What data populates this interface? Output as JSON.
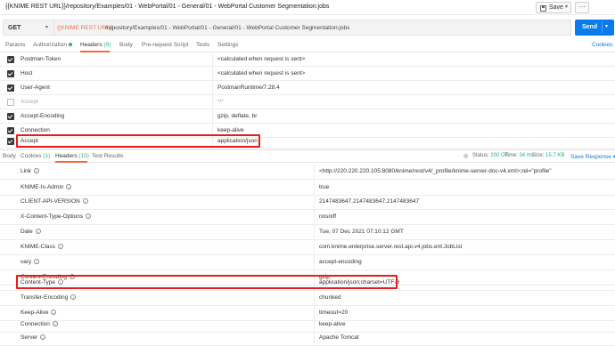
{
  "window": {
    "title": "{{KNIME REST URL}}/repository/Examples/01 - WebPortal/01 - General/01 - WebPortal Customer Segmentation:jobs",
    "save_label": "Save",
    "more_label": "···"
  },
  "request": {
    "method": "GET",
    "url_variable": "{{KNIME REST URL}}",
    "url_path": "/repository/Examples/01 - WebPortal/01 - General/01 - WebPortal Customer Segmentation:jobs",
    "send_label": "Send"
  },
  "request_tabs": [
    {
      "label": "Params"
    },
    {
      "label": "Authorization"
    },
    {
      "label": "Headers",
      "count": "(9)"
    },
    {
      "label": "Body"
    },
    {
      "label": "Pre-request Script"
    },
    {
      "label": "Tests"
    },
    {
      "label": "Settings"
    }
  ],
  "cookies_label": "Cookies",
  "request_headers": [
    {
      "key": "Postman-Token",
      "value": "<calculated when request is sent>",
      "enabled": true
    },
    {
      "key": "Host",
      "value": "<calculated when request is sent>",
      "enabled": true
    },
    {
      "key": "User-Agent",
      "value": "PostmanRuntime/7.28.4",
      "enabled": true
    },
    {
      "key": "Accept",
      "value": "*/*",
      "enabled": false
    },
    {
      "key": "Accept-Encoding",
      "value": "gzip, deflate, br",
      "enabled": true
    },
    {
      "key": "Connection",
      "value": "keep-alive",
      "enabled": true
    },
    {
      "key": "Accept",
      "value": "application/json",
      "enabled": true
    }
  ],
  "response_tabs": [
    {
      "label": "Body"
    },
    {
      "label": "Cookies",
      "count": "(1)"
    },
    {
      "label": "Headers",
      "count": "(15)"
    },
    {
      "label": "Test Results"
    }
  ],
  "response_status": {
    "status_label": "Status:",
    "status_value": "200 OK",
    "time_label": "Time:",
    "time_value": "34 ms",
    "size_label": "Size:",
    "size_value": "15.7 KB",
    "save_response_label": "Save Response"
  },
  "response_headers": [
    {
      "key": "Link",
      "value": "<http://220.220.220.105:8080/knime/rest/v4/_profile/knime-server-doc-v4.xml>;rel=\"profile\""
    },
    {
      "key": "KNIME-Is-Admin",
      "value": "true"
    },
    {
      "key": "CLIENT-API-VERSION",
      "value": "2147483647.2147483647.2147483647"
    },
    {
      "key": "X-Content-Type-Options",
      "value": "nosniff"
    },
    {
      "key": "Date",
      "value": "Tue, 07 Dec 2021 07:10:12 GMT"
    },
    {
      "key": "KNIME-Class",
      "value": "com.knime.enterprise.server.rest.api.v4.jobs.ent.JobList"
    },
    {
      "key": "vary",
      "value": "accept-encoding"
    },
    {
      "key": "Content-Encoding",
      "value": "gzip"
    },
    {
      "key": "Content-Type",
      "value": "application/json;charset=UTF-8"
    },
    {
      "key": "Transfer-Encoding",
      "value": "chunked"
    },
    {
      "key": "Keep-Alive",
      "value": "timeout=20"
    },
    {
      "key": "Connection",
      "value": "keep-alive"
    },
    {
      "key": "Server",
      "value": "Apache Tomcat"
    }
  ],
  "colors": {
    "accent": "#f26b3a",
    "send_blue": "#097bed",
    "status_green": "#26b47f",
    "highlight_red": "#e61d1d"
  }
}
